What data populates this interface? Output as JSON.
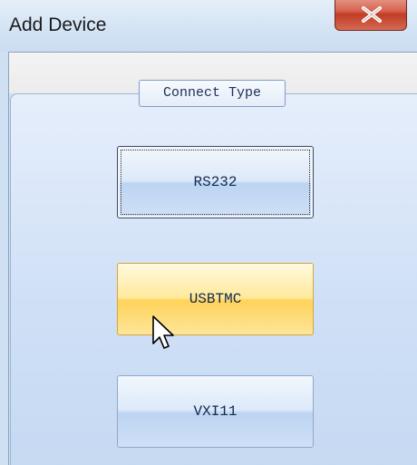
{
  "window": {
    "title": "Add Device",
    "close_icon": "close-x-icon",
    "accent_color": "#c13c25"
  },
  "group": {
    "legend": "Connect Type"
  },
  "buttons": [
    {
      "label": "RS232",
      "state": "focused"
    },
    {
      "label": "USBTMC",
      "state": "hover"
    },
    {
      "label": "VXI11",
      "state": "normal"
    }
  ],
  "cursor": {
    "icon": "arrow-cursor-icon"
  }
}
